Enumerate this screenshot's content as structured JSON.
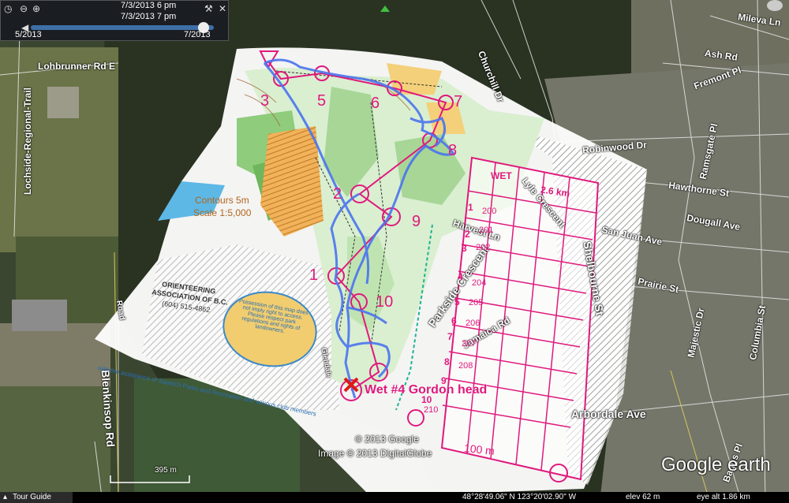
{
  "time_slider": {
    "start_time": "7/3/2013   6 pm",
    "end_time": "7/3/2013   7 pm",
    "range_start": "5/2013",
    "range_end": "7/2013"
  },
  "streets": {
    "lohbrunner": "Lohbrunner Rd E",
    "lochside": "Lochside-Regional-Trail",
    "churchill": "Churchill Dr",
    "mileva": "Mileva Ln",
    "ash": "Ash Rd",
    "fremont": "Fremont Pl",
    "robinwood": "Robinwood Dr",
    "ramsgate": "Ramsgate Pl",
    "hawthorne": "Hawthorne St",
    "dougall": "Dougall Ave",
    "san_juan": "San Juan Ave",
    "prairie": "Prairie St",
    "majestic": "Majestic Dr",
    "columbia": "Columbia St",
    "arbordale": "Arbordale Ave",
    "blenkinsop": "Blenkinsop Rd",
    "baggs": "Baggs Pl",
    "harvest": "Harvest Ln",
    "lyle": "Lyle Crescent",
    "parkside": "Parkside Crescent",
    "shelbourne": "Shelbourne St",
    "jamaica": "Jamaica Rd",
    "road_left": "Road",
    "glendale": "Glendale"
  },
  "map_overlay": {
    "contours": "Contours 5m",
    "scale": "Scale 1:5,000",
    "club_name": "ORIENTEERING",
    "club_name2": "ASSOCIATION OF B.C.",
    "club_phone": "(604) 515-4862",
    "notice": "Possession of this map does not imply right to access. Please respect park regulations and rights of landowners.",
    "credit": "with the assistance of Saanich Parks and Recreation and various club members",
    "event_title": "Wet #4 Gordon head",
    "scale_bar": "100 m",
    "controls": [
      "1",
      "2",
      "3",
      "5",
      "6",
      "7",
      "8",
      "9",
      "10"
    ],
    "control_card": {
      "title": "WET",
      "distance": "2.6 km",
      "codes": [
        "200",
        "201",
        "202",
        "204",
        "205",
        "206",
        "207",
        "208",
        "210"
      ],
      "numbers": [
        "1",
        "2",
        "3",
        "4",
        "5",
        "6",
        "7",
        "8",
        "9",
        "10"
      ]
    }
  },
  "copyright": {
    "google": "© 2013 Google",
    "image": "Image © 2013 DigitalGlobe"
  },
  "scale_legend": "395 m",
  "logo": "Google earth",
  "status_bar": {
    "tour_guide": "Tour Guide",
    "coords": "48°28'49.06\" N  123°20'02.90\" W",
    "elev": "elev   62 m",
    "eye_alt": "eye alt   1.86 km"
  },
  "colors": {
    "course": "#e0197d",
    "track": "#4b74ee",
    "forest": "#33402a"
  }
}
